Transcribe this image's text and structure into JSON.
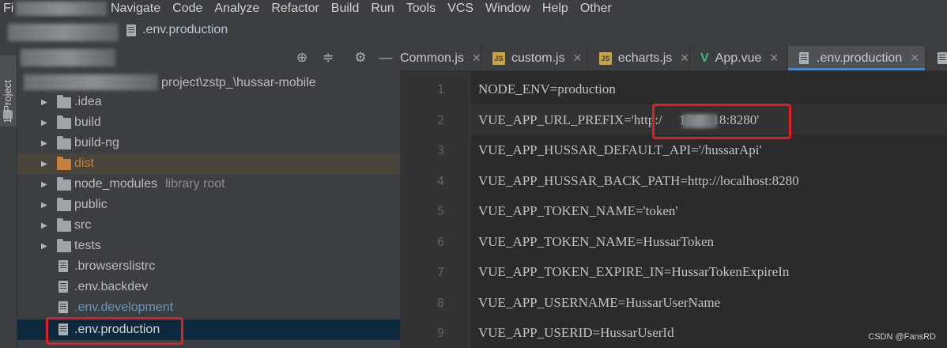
{
  "menu": [
    "File",
    "Navigate",
    "Code",
    "Analyze",
    "Refactor",
    "Build",
    "Run",
    "Tools",
    "VCS",
    "Window",
    "Help",
    "Other"
  ],
  "menu_visible": [
    "Fi",
    "Navigate",
    "Code",
    "Analyze",
    "Refactor",
    "Build",
    "Run",
    "Tools",
    "VCS",
    "Window",
    "Help",
    "Other"
  ],
  "navbar": {
    "file": ".env.production"
  },
  "stripe": {
    "label": "1: Project"
  },
  "project": {
    "path": "project\\zstp_\\hussar-mobile",
    "items": [
      {
        "name": ".idea",
        "type": "folder"
      },
      {
        "name": "build",
        "type": "folder"
      },
      {
        "name": "build-ng",
        "type": "folder"
      },
      {
        "name": "dist",
        "type": "folder",
        "color": "#c6803c"
      },
      {
        "name": "node_modules",
        "type": "folder",
        "note": "library root"
      },
      {
        "name": "public",
        "type": "folder"
      },
      {
        "name": "src",
        "type": "folder"
      },
      {
        "name": "tests",
        "type": "folder"
      },
      {
        "name": ".browserslistrc",
        "type": "file"
      },
      {
        "name": ".env.backdev",
        "type": "file"
      },
      {
        "name": ".env.development",
        "type": "file",
        "color": "#6897bb"
      },
      {
        "name": ".env.production",
        "type": "file",
        "selected": true
      }
    ]
  },
  "tabs": [
    {
      "label": "Common.js"
    },
    {
      "label": "custom.js"
    },
    {
      "label": "echarts.js"
    },
    {
      "label": "App.vue"
    },
    {
      "label": ".env.production",
      "active": true
    }
  ],
  "code": {
    "lines": [
      {
        "num": "1",
        "text": "NODE_ENV=production"
      },
      {
        "num": "2",
        "text": "VUE_APP_URL_PREFIX='http:/     17.70.18:8280'"
      },
      {
        "num": "3",
        "text": "VUE_APP_HUSSAR_DEFAULT_API='/hussarApi'"
      },
      {
        "num": "4",
        "text": "VUE_APP_HUSSAR_BACK_PATH=http://localhost:8280"
      },
      {
        "num": "5",
        "text": "VUE_APP_TOKEN_NAME='token'"
      },
      {
        "num": "6",
        "text": "VUE_APP_TOKEN_NAME=HussarToken"
      },
      {
        "num": "7",
        "text": "VUE_APP_TOKEN_EXPIRE_IN=HussarTokenExpireIn"
      },
      {
        "num": "8",
        "text": "VUE_APP_USERNAME=HussarUserName"
      },
      {
        "num": "9",
        "text": "VUE_APP_USERID=HussarUserId"
      }
    ]
  },
  "watermark": "CSDN @FansRD",
  "colors": {
    "accent": "#4a88c7",
    "highlight": "#e02020",
    "selection": "#0d293e"
  }
}
